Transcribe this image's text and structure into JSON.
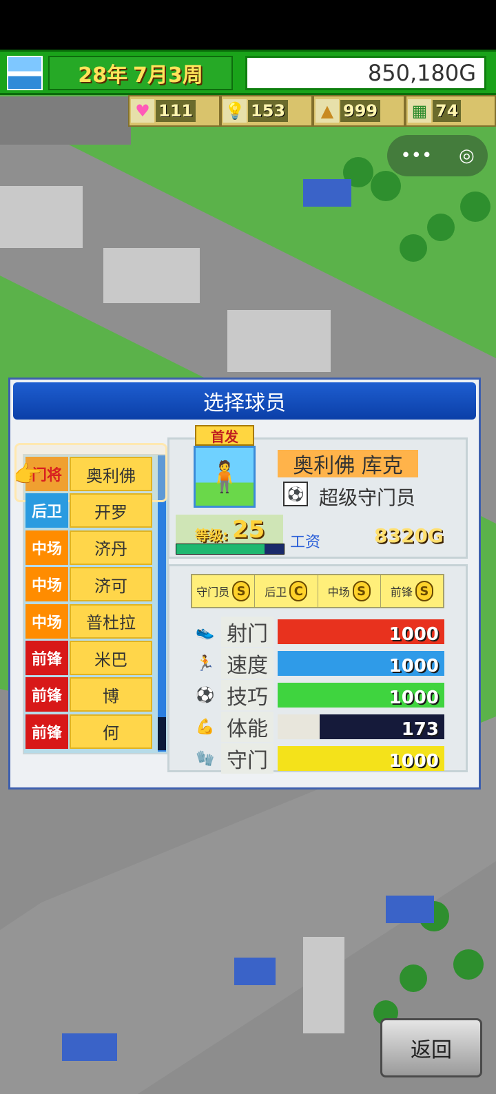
{
  "hud": {
    "year": "28年",
    "week": "7月3周",
    "money": "850,180G"
  },
  "stats": [
    {
      "icon": "heart-icon",
      "value": "111"
    },
    {
      "icon": "bulb-icon",
      "value": "153"
    },
    {
      "icon": "hill-icon",
      "value": "999"
    },
    {
      "icon": "field-icon",
      "value": "74"
    }
  ],
  "dialog": {
    "title": "选择球员",
    "roster": [
      {
        "pos": "门将",
        "name": "奥利佛",
        "pos_class": "pos-gk"
      },
      {
        "pos": "后卫",
        "name": "开罗",
        "pos_class": "pos-df"
      },
      {
        "pos": "中场",
        "name": "济丹",
        "pos_class": "pos-mf"
      },
      {
        "pos": "中场",
        "name": "济可",
        "pos_class": "pos-mf"
      },
      {
        "pos": "中场",
        "name": "普杜拉",
        "pos_class": "pos-mf"
      },
      {
        "pos": "前锋",
        "name": "米巴",
        "pos_class": "pos-fw"
      },
      {
        "pos": "前锋",
        "name": "博",
        "pos_class": "pos-fw"
      },
      {
        "pos": "前锋",
        "name": "何",
        "pos_class": "pos-fw"
      }
    ],
    "player": {
      "starter_label": "首发",
      "name": "奥利佛 库克",
      "role": "超级守门员",
      "level_label": "等级:",
      "level": "25",
      "exp_progress": 0.82,
      "salary_label": "工资",
      "salary": "8320G"
    },
    "aptitudes": [
      {
        "label": "守门员",
        "grade": "S"
      },
      {
        "label": "后卫",
        "grade": "C"
      },
      {
        "label": "中场",
        "grade": "S"
      },
      {
        "label": "前锋",
        "grade": "S"
      }
    ],
    "attributes": [
      {
        "label": "射门",
        "value": "1000",
        "ratio": 1.0,
        "color": "#e8321e",
        "icon": "shoot-icon"
      },
      {
        "label": "速度",
        "value": "1000",
        "ratio": 1.0,
        "color": "#2f9be8",
        "icon": "speed-icon"
      },
      {
        "label": "技巧",
        "value": "1000",
        "ratio": 1.0,
        "color": "#3fd43f",
        "icon": "skill-icon"
      },
      {
        "label": "体能",
        "value": "173",
        "ratio": 0.25,
        "color": "#e8e6dc",
        "icon": "stamina-icon"
      },
      {
        "label": "守门",
        "value": "1000",
        "ratio": 1.0,
        "color": "#f4e21a",
        "icon": "keeper-icon"
      }
    ]
  },
  "back_label": "返回"
}
